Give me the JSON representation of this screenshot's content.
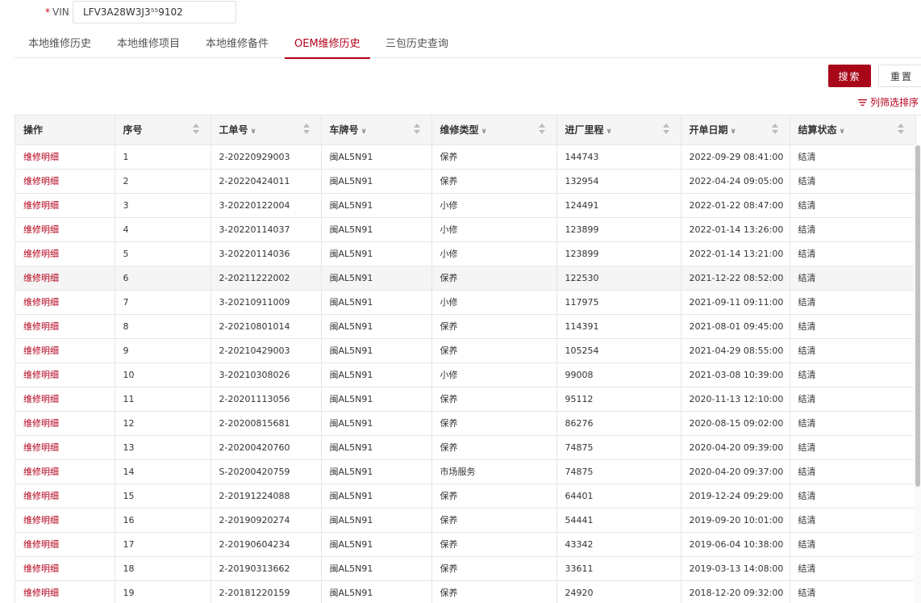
{
  "vin": {
    "label": "VIN",
    "required_mark": "*",
    "value": "LFV3A28W3J3⁵⁵9102"
  },
  "tabs": [
    "本地维修历史",
    "本地维修项目",
    "本地维修备件",
    "OEM维修历史",
    "三包历史查询"
  ],
  "active_tab": 3,
  "toolbar": {
    "search_label": "搜索",
    "reset_label": "重置",
    "column_filter_label": "列筛选排序"
  },
  "table": {
    "columns": [
      {
        "label": "操作",
        "filter": false,
        "sort": false
      },
      {
        "label": "序号",
        "filter": false,
        "sort": true
      },
      {
        "label": "工单号",
        "filter": true,
        "sort": true
      },
      {
        "label": "车牌号",
        "filter": true,
        "sort": true
      },
      {
        "label": "维修类型",
        "filter": true,
        "sort": true
      },
      {
        "label": "进厂里程",
        "filter": true,
        "sort": true
      },
      {
        "label": "开单日期",
        "filter": true,
        "sort": true
      },
      {
        "label": "结算状态",
        "filter": true,
        "sort": true
      }
    ],
    "highlighted_row": 5,
    "rows": [
      [
        "维修明细",
        "1",
        "2-20220929003",
        "闽AL5N91",
        "保养",
        "144743",
        "2022-09-29 08:41:00",
        "结清"
      ],
      [
        "维修明细",
        "2",
        "2-20220424011",
        "闽AL5N91",
        "保养",
        "132954",
        "2022-04-24 09:05:00",
        "结清"
      ],
      [
        "维修明细",
        "3",
        "3-20220122004",
        "闽AL5N91",
        "小修",
        "124491",
        "2022-01-22 08:47:00",
        "结清"
      ],
      [
        "维修明细",
        "4",
        "3-20220114037",
        "闽AL5N91",
        "小修",
        "123899",
        "2022-01-14 13:26:00",
        "结清"
      ],
      [
        "维修明细",
        "5",
        "3-20220114036",
        "闽AL5N91",
        "小修",
        "123899",
        "2022-01-14 13:21:00",
        "结清"
      ],
      [
        "维修明细",
        "6",
        "2-20211222002",
        "闽AL5N91",
        "保养",
        "122530",
        "2021-12-22 08:52:00",
        "结清"
      ],
      [
        "维修明细",
        "7",
        "3-20210911009",
        "闽AL5N91",
        "小修",
        "117975",
        "2021-09-11 09:11:00",
        "结清"
      ],
      [
        "维修明细",
        "8",
        "2-20210801014",
        "闽AL5N91",
        "保养",
        "114391",
        "2021-08-01 09:45:00",
        "结清"
      ],
      [
        "维修明细",
        "9",
        "2-20210429003",
        "闽AL5N91",
        "保养",
        "105254",
        "2021-04-29 08:55:00",
        "结清"
      ],
      [
        "维修明细",
        "10",
        "3-20210308026",
        "闽AL5N91",
        "小修",
        "99008",
        "2021-03-08 10:39:00",
        "结清"
      ],
      [
        "维修明细",
        "11",
        "2-20201113056",
        "闽AL5N91",
        "保养",
        "95112",
        "2020-11-13 12:10:00",
        "结清"
      ],
      [
        "维修明细",
        "12",
        "2-20200815681",
        "闽AL5N91",
        "保养",
        "86276",
        "2020-08-15 09:02:00",
        "结清"
      ],
      [
        "维修明细",
        "13",
        "2-20200420760",
        "闽AL5N91",
        "保养",
        "74875",
        "2020-04-20 09:39:00",
        "结清"
      ],
      [
        "维修明细",
        "14",
        "S-20200420759",
        "闽AL5N91",
        "市场服务",
        "74875",
        "2020-04-20 09:37:00",
        "结清"
      ],
      [
        "维修明细",
        "15",
        "2-20191224088",
        "闽AL5N91",
        "保养",
        "64401",
        "2019-12-24 09:29:00",
        "结清"
      ],
      [
        "维修明细",
        "16",
        "2-20190920274",
        "闽AL5N91",
        "保养",
        "54441",
        "2019-09-20 10:01:00",
        "结清"
      ],
      [
        "维修明细",
        "17",
        "2-20190604234",
        "闽AL5N91",
        "保养",
        "43342",
        "2019-06-04 10:38:00",
        "结清"
      ],
      [
        "维修明细",
        "18",
        "2-20190313662",
        "闽AL5N91",
        "保养",
        "33611",
        "2019-03-13 14:08:00",
        "结清"
      ],
      [
        "维修明细",
        "19",
        "2-20181220159",
        "闽AL5N91",
        "保养",
        "24920",
        "2018-12-20 09:32:00",
        "结清"
      ]
    ]
  },
  "colors": {
    "accent": "#b3001b",
    "button": "#a8071a",
    "header_bg": "#f5f5f5",
    "border": "#e6e6e6"
  }
}
